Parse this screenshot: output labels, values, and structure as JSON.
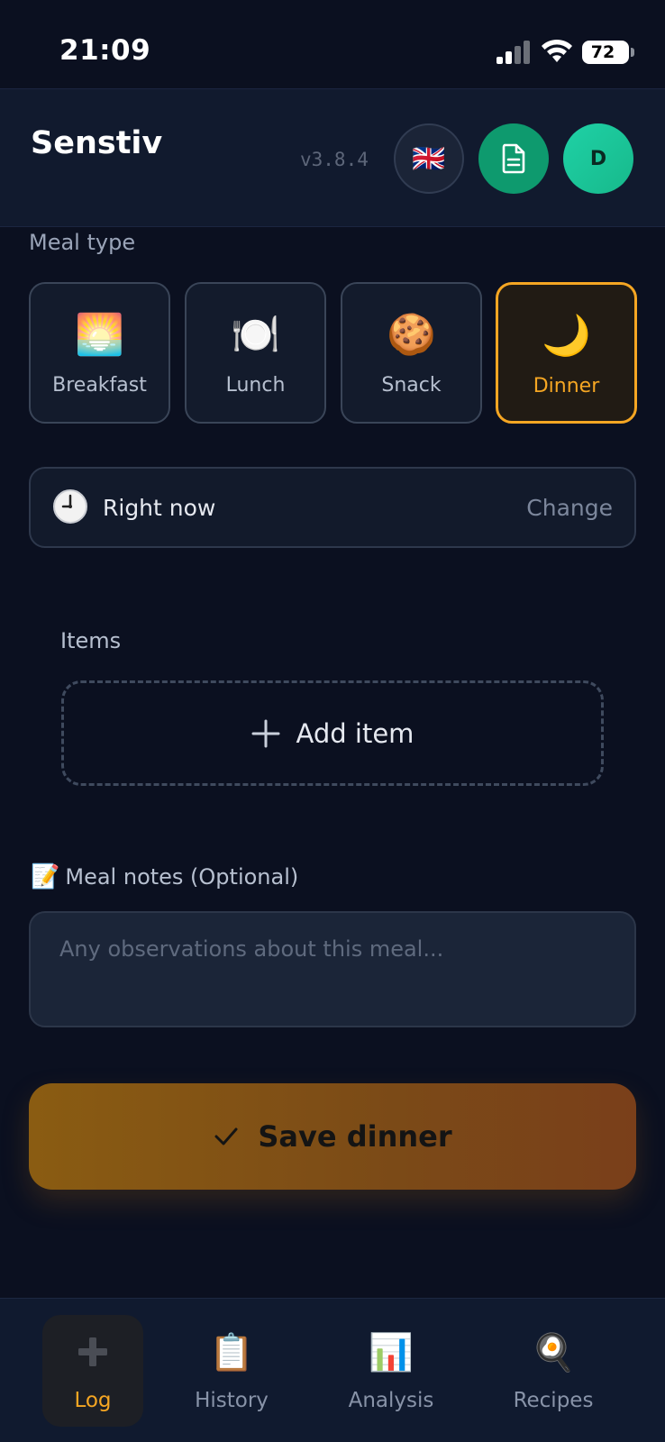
{
  "status_bar": {
    "time": "21:09",
    "battery": "72"
  },
  "header": {
    "title": "Senstiv",
    "version": "v3.8.4",
    "language_flag": "🇬🇧",
    "avatar_initial": "D"
  },
  "meal_type": {
    "label": "Meal type",
    "options": [
      {
        "emoji": "🌅",
        "label": "Breakfast"
      },
      {
        "emoji": "🍽️",
        "label": "Lunch"
      },
      {
        "emoji": "🍪",
        "label": "Snack"
      },
      {
        "emoji": "🌙",
        "label": "Dinner"
      }
    ],
    "selected": "Dinner"
  },
  "time": {
    "value": "Right now",
    "change_label": "Change"
  },
  "items": {
    "label": "Items",
    "add_label": "Add item"
  },
  "notes": {
    "emoji": "📝",
    "label": "Meal notes (Optional)",
    "placeholder": "Any observations about this meal..."
  },
  "save_button": {
    "label": "Save dinner"
  },
  "tabs": [
    {
      "label": "Log",
      "icon": "plus-icon"
    },
    {
      "label": "History",
      "icon": "📋"
    },
    {
      "label": "Analysis",
      "icon": "📊"
    },
    {
      "label": "Recipes",
      "icon": "🍳"
    }
  ],
  "active_tab": "Log",
  "colors": {
    "accent": "#f5a623",
    "background": "#0b1020",
    "doc_button": "#0e9a6e",
    "avatar": "#1fd1a6"
  }
}
